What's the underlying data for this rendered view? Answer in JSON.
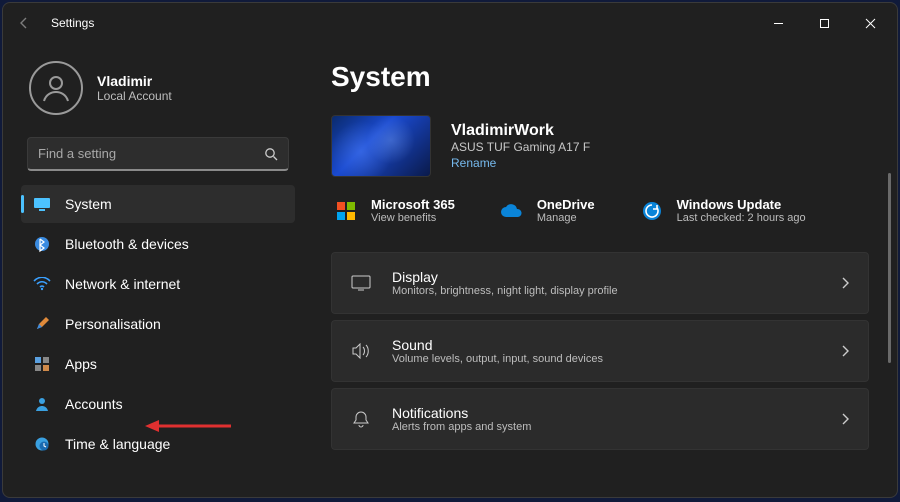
{
  "window": {
    "title": "Settings"
  },
  "profile": {
    "name": "Vladimir",
    "sub": "Local Account"
  },
  "search": {
    "placeholder": "Find a setting"
  },
  "nav": {
    "items": [
      {
        "label": "System"
      },
      {
        "label": "Bluetooth & devices"
      },
      {
        "label": "Network & internet"
      },
      {
        "label": "Personalisation"
      },
      {
        "label": "Apps"
      },
      {
        "label": "Accounts"
      },
      {
        "label": "Time & language"
      }
    ]
  },
  "page": {
    "heading": "System"
  },
  "device": {
    "name": "VladimirWork",
    "model": "ASUS TUF Gaming A17 F",
    "rename": "Rename"
  },
  "tiles": {
    "m365": {
      "title": "Microsoft 365",
      "sub": "View benefits"
    },
    "onedrive": {
      "title": "OneDrive",
      "sub": "Manage"
    },
    "winupdate": {
      "title": "Windows Update",
      "sub": "Last checked: 2 hours ago"
    }
  },
  "cards": {
    "display": {
      "title": "Display",
      "sub": "Monitors, brightness, night light, display profile"
    },
    "sound": {
      "title": "Sound",
      "sub": "Volume levels, output, input, sound devices"
    },
    "notifications": {
      "title": "Notifications",
      "sub": "Alerts from apps and system"
    }
  },
  "colors": {
    "accent": "#4cc2ff"
  }
}
